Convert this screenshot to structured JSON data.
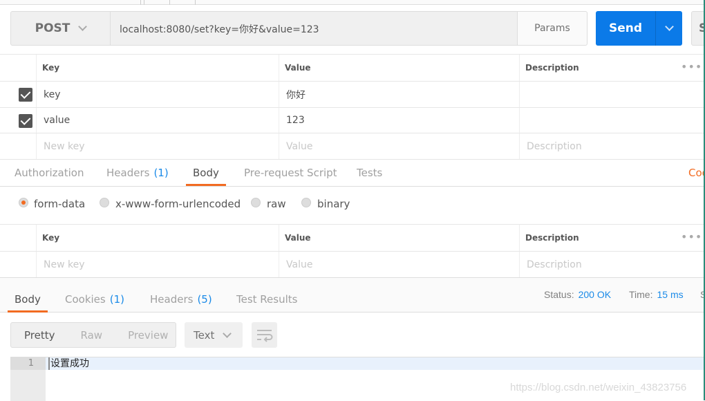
{
  "request": {
    "method": "POST",
    "url": "localhost:8080/set?key=你好&value=123",
    "params_label": "Params",
    "send_label": "Send",
    "save_label": "S"
  },
  "params_table": {
    "headers": {
      "key": "Key",
      "value": "Value",
      "description": "Description"
    },
    "rows": [
      {
        "checked": true,
        "key": "key",
        "value": "你好",
        "description": ""
      },
      {
        "checked": true,
        "key": "value",
        "value": "123",
        "description": ""
      }
    ],
    "placeholder": {
      "key": "New key",
      "value": "Value",
      "description": "Description"
    }
  },
  "request_tabs": {
    "items": [
      {
        "label": "Authorization",
        "count": ""
      },
      {
        "label": "Headers",
        "count": "(1)"
      },
      {
        "label": "Body",
        "count": ""
      },
      {
        "label": "Pre-request Script",
        "count": ""
      },
      {
        "label": "Tests",
        "count": ""
      }
    ],
    "active": "Body",
    "right_link": "Coo"
  },
  "body_modes": {
    "options": [
      "form-data",
      "x-www-form-urlencoded",
      "raw",
      "binary"
    ],
    "selected": "form-data"
  },
  "body_table": {
    "headers": {
      "key": "Key",
      "value": "Value",
      "description": "Description"
    },
    "placeholder": {
      "key": "New key",
      "value": "Value",
      "description": "Description"
    }
  },
  "response_tabs": {
    "items": [
      {
        "label": "Body",
        "count": ""
      },
      {
        "label": "Cookies",
        "count": "(1)"
      },
      {
        "label": "Headers",
        "count": "(5)"
      },
      {
        "label": "Test Results",
        "count": ""
      }
    ],
    "active": "Body"
  },
  "response_status": {
    "status_label": "Status:",
    "status_value": "200 OK",
    "time_label": "Time:",
    "time_value": "15 ms",
    "size_label": "S"
  },
  "response_view": {
    "modes": [
      "Pretty",
      "Raw",
      "Preview"
    ],
    "selected_mode": "Pretty",
    "format": "Text"
  },
  "response_body": {
    "lines": [
      {
        "number": "1",
        "text": "设置成功"
      }
    ]
  },
  "watermark": "https://blog.csdn.net/weixin_43823756",
  "colors": {
    "accent": "#f26b21",
    "send": "#0b7ae8",
    "link": "#1a8ae8"
  }
}
